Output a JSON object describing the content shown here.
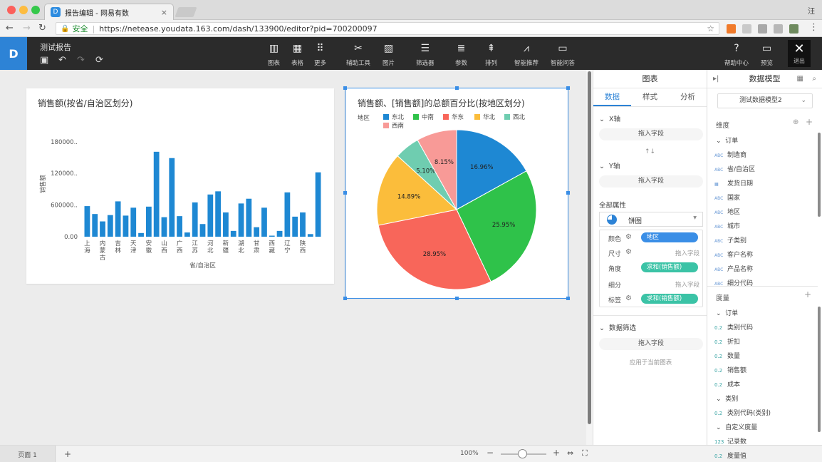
{
  "browser": {
    "tab_title": "报告编辑 - 网易有数",
    "tab_close": "×",
    "user_initial": "汪",
    "secure_label": "安全",
    "url": "https://netease.youdata.163.com/dash/133900/editor?pid=700200097",
    "colors": {
      "close": "#fc605b",
      "minimize": "#fdbc40",
      "maximize": "#34c84a"
    }
  },
  "header": {
    "report_name": "测试报告",
    "tools": [
      {
        "label": "图表",
        "icon": "bar-chart-icon"
      },
      {
        "label": "表格",
        "icon": "table-icon"
      },
      {
        "label": "更多",
        "icon": "grid-more-icon"
      },
      {
        "label": "辅助工具",
        "icon": "tools-icon"
      },
      {
        "label": "图片",
        "icon": "image-icon"
      },
      {
        "label": "筛选器",
        "icon": "filter-list-icon"
      },
      {
        "label": "参数",
        "icon": "sliders-icon"
      },
      {
        "label": "排列",
        "icon": "arrange-icon"
      },
      {
        "label": "智能推荐",
        "icon": "trend-chart-icon"
      },
      {
        "label": "智能问答",
        "icon": "chat-icon"
      }
    ],
    "help_label": "帮助中心",
    "preview_label": "预览",
    "exit_label": "退出"
  },
  "canvas": {
    "bar_card": {
      "title": "销售额(按省/自治区划分)"
    },
    "pie_card": {
      "title": "销售额、[销售额]的总额百分比(按地区划分)"
    }
  },
  "chart_data": [
    {
      "type": "bar",
      "title": "销售额(按省/自治区划分)",
      "xlabel": "省/自治区",
      "ylabel": "销售额",
      "yticks": [
        "180000..",
        "120000..",
        "600000..",
        "0.00"
      ],
      "ylim": [
        0,
        200000
      ],
      "color": "#1e88d3",
      "categories": [
        "上海",
        "",
        "内蒙古",
        "",
        "吉林",
        "",
        "天津",
        "",
        "安徽",
        "",
        "山西",
        "",
        "广西",
        "",
        "江苏",
        "",
        "河北",
        "",
        "新疆",
        "",
        "湖北",
        "",
        "甘肃",
        "",
        "西藏",
        "",
        "辽宁",
        "",
        "陕西",
        ""
      ],
      "values": [
        58000,
        43000,
        29000,
        41000,
        67000,
        40000,
        55000,
        7000,
        57000,
        161000,
        37000,
        149000,
        39000,
        8000,
        65000,
        24000,
        80000,
        86000,
        46000,
        11000,
        63000,
        72000,
        18000,
        55000,
        2000,
        11000,
        84000,
        38000,
        46000,
        5000,
        122000
      ]
    },
    {
      "type": "pie",
      "title": "销售额、[销售额]的总额百分比(按地区划分)",
      "legend_title": "地区",
      "labels": [
        "东北",
        "中南",
        "华东",
        "华北",
        "西北",
        "西南"
      ],
      "values": [
        16.96,
        25.95,
        28.95,
        14.89,
        5.1,
        8.15
      ],
      "value_labels": [
        "16.96%",
        "25.95%",
        "28.95%",
        "14.89%",
        "5.10%",
        "8.15%"
      ],
      "colors": [
        "#1e88d3",
        "#2fc24a",
        "#f8665a",
        "#fbbd3b",
        "#6fcdb0",
        "#f89a97"
      ]
    }
  ],
  "footer": {
    "page_tab": "页面 1",
    "add_page": "+",
    "zoom": "100%",
    "zoom_level": 1.0
  },
  "chart_panel": {
    "title": "图表",
    "tabs": [
      "数据",
      "样式",
      "分析"
    ],
    "x_axis": "X轴",
    "y_axis": "Y轴",
    "drop_hint": "拖入字段",
    "swap_icon": "↑↓",
    "all_props": "全部属性",
    "chart_type": "饼图",
    "props": {
      "color": {
        "key": "颜色",
        "value": "地区",
        "pill_color": "#3a8ee6"
      },
      "size": {
        "key": "尺寸",
        "value": "拖入字段"
      },
      "angle": {
        "key": "角度",
        "value": "求和(销售额)",
        "pill_color": "#3bc3a6"
      },
      "detail": {
        "key": "细分",
        "value": "拖入字段"
      },
      "label": {
        "key": "标签",
        "value": "求和(销售额)",
        "pill_color": "#3bc3a6"
      }
    },
    "filter_section": "数据筛选",
    "filter_drop": "拖入字段",
    "filter_hint": "应用于当前图表"
  },
  "model_panel": {
    "title": "数据模型",
    "model_name": "测试数据模型2",
    "dimensions": "维度",
    "dim_group": "订单",
    "dim_items": [
      {
        "type": "ABC",
        "label": "制造商"
      },
      {
        "type": "ABC",
        "label": "省/自治区"
      },
      {
        "type": "date",
        "label": "发货日期"
      },
      {
        "type": "ABC",
        "label": "国家"
      },
      {
        "type": "ABC",
        "label": "地区"
      },
      {
        "type": "ABC",
        "label": "城市"
      },
      {
        "type": "ABC",
        "label": "子类别"
      },
      {
        "type": "ABC",
        "label": "客户名称"
      },
      {
        "type": "ABC",
        "label": "产品名称"
      },
      {
        "type": "ABC",
        "label": "细分代码"
      }
    ],
    "measures": "度量",
    "measure_groups": [
      {
        "name": "订单",
        "items": [
          {
            "type": "0.2",
            "label": "类别代码"
          },
          {
            "type": "0.2",
            "label": "折扣"
          },
          {
            "type": "0.2",
            "label": "数量"
          },
          {
            "type": "0.2",
            "label": "销售额"
          },
          {
            "type": "0.2",
            "label": "成本"
          }
        ]
      },
      {
        "name": "类别",
        "items": [
          {
            "type": "0.2",
            "label": "类别代码(类别)"
          }
        ]
      },
      {
        "name": "自定义度量",
        "items": [
          {
            "type": "123",
            "label": "记录数"
          },
          {
            "type": "0.2",
            "label": "度量值"
          }
        ]
      }
    ]
  }
}
